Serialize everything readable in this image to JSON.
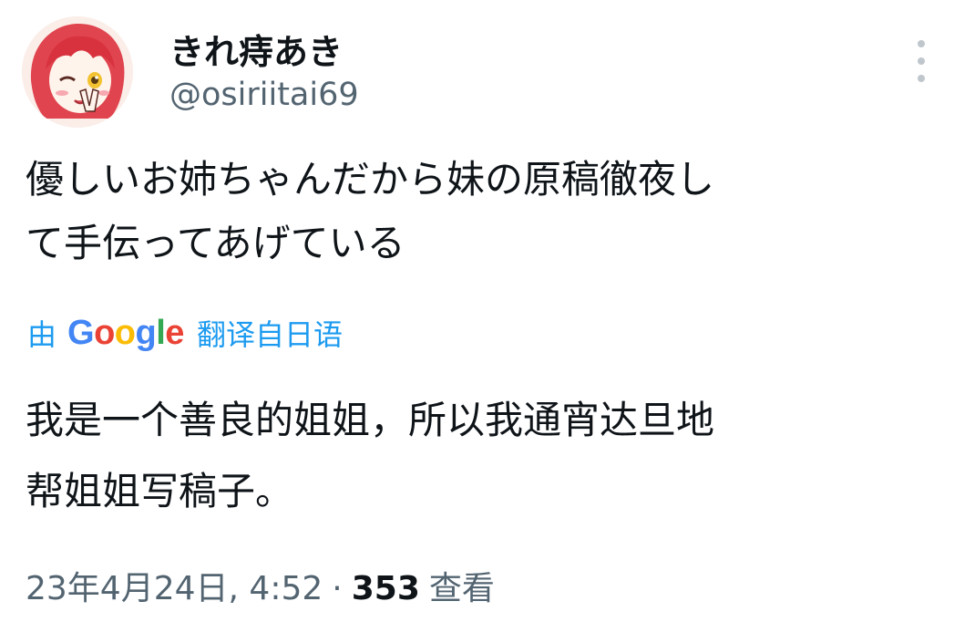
{
  "user": {
    "display_name": "きれ痔あき",
    "handle": "@osiriitai69"
  },
  "menu": {
    "icon": "more-vertical-icon"
  },
  "tweet": {
    "lines": [
      "優しいお姉ちゃんだから妹の原稿徹夜し",
      "て手伝ってあげている"
    ]
  },
  "translation": {
    "by": "由",
    "provider_letters": [
      "G",
      "o",
      "o",
      "g",
      "l",
      "e"
    ],
    "provider_colors": [
      "#4285F4",
      "#EA4335",
      "#FBBC05",
      "#4285F4",
      "#34A853",
      "#EA4335"
    ],
    "link": "翻译自日语",
    "lines": [
      "我是一个善良的姐姐，所以我通宵达旦地",
      "帮姐姐写稿子。"
    ]
  },
  "meta": {
    "datetime": "23年4月24日, 4:52",
    "separator": "·",
    "views_count": "353",
    "views_label": "查看"
  },
  "colors": {
    "accent": "#1d9bf0",
    "text": "#0f1419",
    "secondary": "#536471"
  }
}
